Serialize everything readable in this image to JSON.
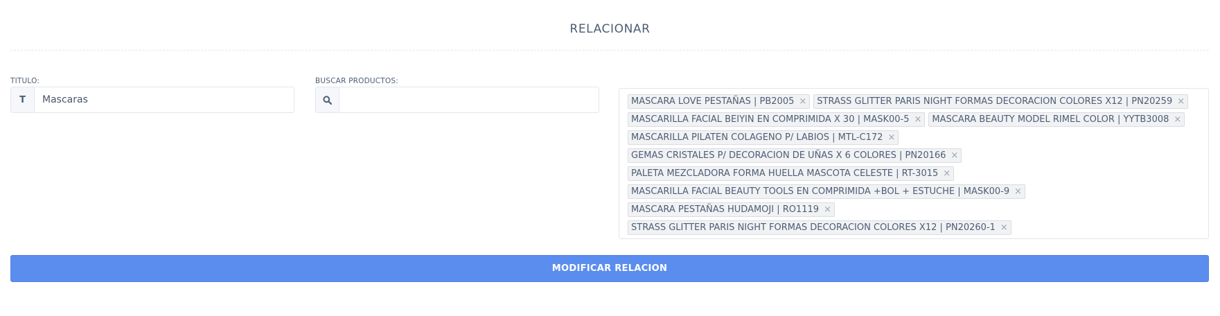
{
  "header": {
    "title": "RELACIONAR"
  },
  "form": {
    "titulo": {
      "label": "TITULO:",
      "addon": "T",
      "value": "Mascaras"
    },
    "buscar": {
      "label": "BUSCAR PRODUCTOS:",
      "icon": "search-icon",
      "value": ""
    },
    "tags_rows": [
      [
        "MASCARA LOVE PESTAÑAS | PB2005",
        "STRASS GLITTER PARIS NIGHT FORMAS DECORACION COLORES X12 | PN20259"
      ],
      [
        "MASCARILLA FACIAL BEIYIN EN COMPRIMIDA X 30 | MASK00-5",
        "MASCARA BEAUTY MODEL RIMEL COLOR | YYTB3008"
      ],
      [
        "MASCARILLA PILATEN COLAGENO P/ LABIOS | MTL-C172"
      ],
      [
        "GEMAS CRISTALES P/ DECORACION DE UÑAS X 6 COLORES | PN20166"
      ],
      [
        "PALETA MEZCLADORA FORMA HUELLA MASCOTA CELESTE | RT-3015"
      ],
      [
        "MASCARILLA FACIAL BEAUTY TOOLS EN COMPRIMIDA +BOL + ESTUCHE | MASK00-9"
      ],
      [
        "MASCARA PESTAÑAS HUDAMOJI | RO1119"
      ],
      [
        "STRASS GLITTER PARIS NIGHT FORMAS DECORACION COLORES X12 | PN20260-1"
      ]
    ],
    "tag_remove_symbol": "×",
    "submit_label": "MODIFICAR RELACION"
  },
  "colors": {
    "accent": "#5b8def",
    "text": "#4d5d75",
    "border": "#e2e6ec",
    "tag_bg": "#f1f2f4"
  }
}
